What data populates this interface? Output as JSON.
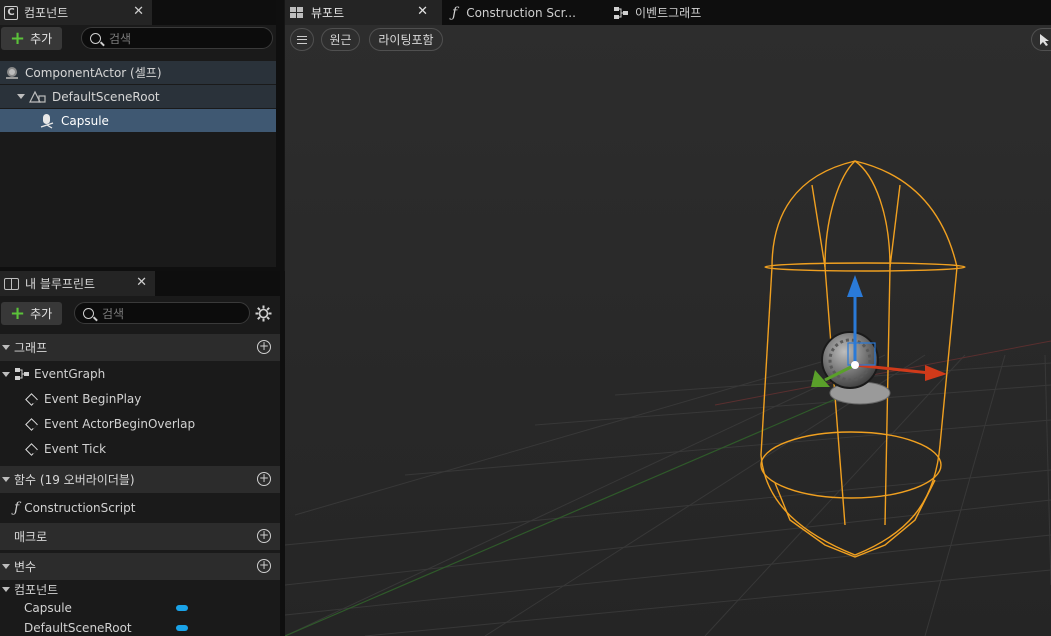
{
  "components_panel": {
    "tab_title": "컴포넌트",
    "add_label": "추가",
    "search_placeholder": "검색",
    "tree": [
      {
        "label": "ComponentActor (셀프)"
      },
      {
        "label": "DefaultSceneRoot"
      },
      {
        "label": "Capsule"
      }
    ]
  },
  "blueprint_panel": {
    "tab_title": "내 블루프린트",
    "add_label": "추가",
    "search_placeholder": "검색",
    "sections": {
      "graphs": "그래프",
      "event_graph": "EventGraph",
      "events": [
        "Event BeginPlay",
        "Event ActorBeginOverlap",
        "Event Tick"
      ],
      "functions": "함수 (19 오버라이더블)",
      "construction_script": "ConstructionScript",
      "macros": "매크로",
      "variables": "변수",
      "components_group": "컴포넌트",
      "variable_items": [
        "Capsule",
        "DefaultSceneRoot"
      ]
    }
  },
  "editor_tabs": [
    {
      "label": "뷰포트"
    },
    {
      "label": "Construction Scr..."
    },
    {
      "label": "이벤트그래프"
    }
  ],
  "viewport": {
    "perspective_label": "원근",
    "lighting_label": "라이팅포함"
  },
  "colors": {
    "selection": "#3f5872",
    "capsule_wire": "#f0a020",
    "axis_x": "#d03a1a",
    "axis_y": "#5aa02a",
    "axis_z": "#2a7ad8"
  }
}
